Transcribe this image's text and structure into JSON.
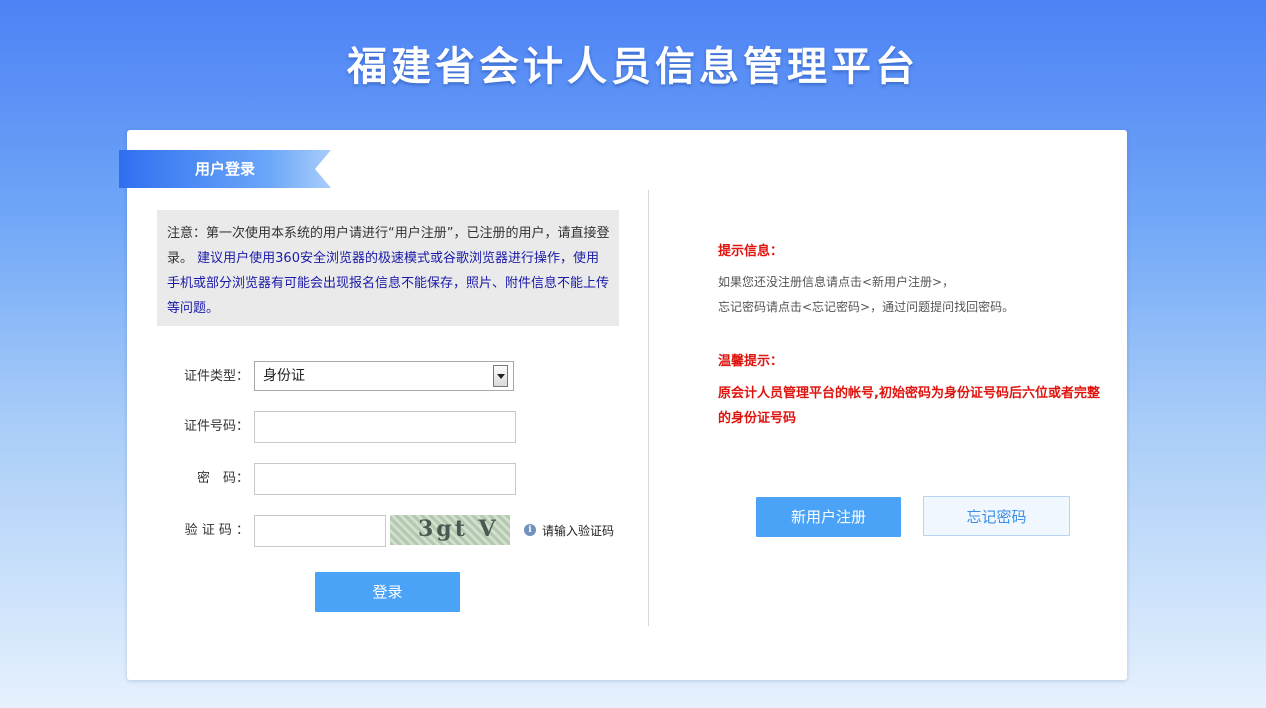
{
  "site": {
    "title": "福建省会计人员信息管理平台"
  },
  "login": {
    "heading": "用户登录",
    "notice_prefix": "注意：第一次使用本系统的用户请进行“用户注册”，已注册的用户，请直接登录。",
    "notice_highlight": "建议用户使用360安全浏览器的极速模式或谷歌浏览器进行操作，使用手机或部分浏览器有可能会出现报名信息不能保存，照片、附件信息不能上传等问题。",
    "id_type_label": "证件类型：",
    "id_type_value": "身份证",
    "id_number_label": "证件号码：",
    "password_label": "密　码：",
    "captcha_label": "验 证 码 ：",
    "captcha_image_text": "3gt V",
    "captcha_hint": "请输入验证码",
    "submit_label": "登录"
  },
  "tips": {
    "heading": "提示信息：",
    "line1": "如果您还没注册信息请点击<新用户注册>，",
    "line2": "忘记密码请点击<忘记密码>，通过问题提问找回密码。",
    "warm_heading": "温馨提示：",
    "warm_text": "原会计人员管理平台的帐号,初始密码为身份证号码后六位或者完整的身份证号码"
  },
  "actions": {
    "register_label": "新用户注册",
    "forgot_label": "忘记密码"
  },
  "colors": {
    "accent": "#4ba3f7",
    "alert": "#e0140e",
    "notice_blue": "#1a1aa8"
  }
}
